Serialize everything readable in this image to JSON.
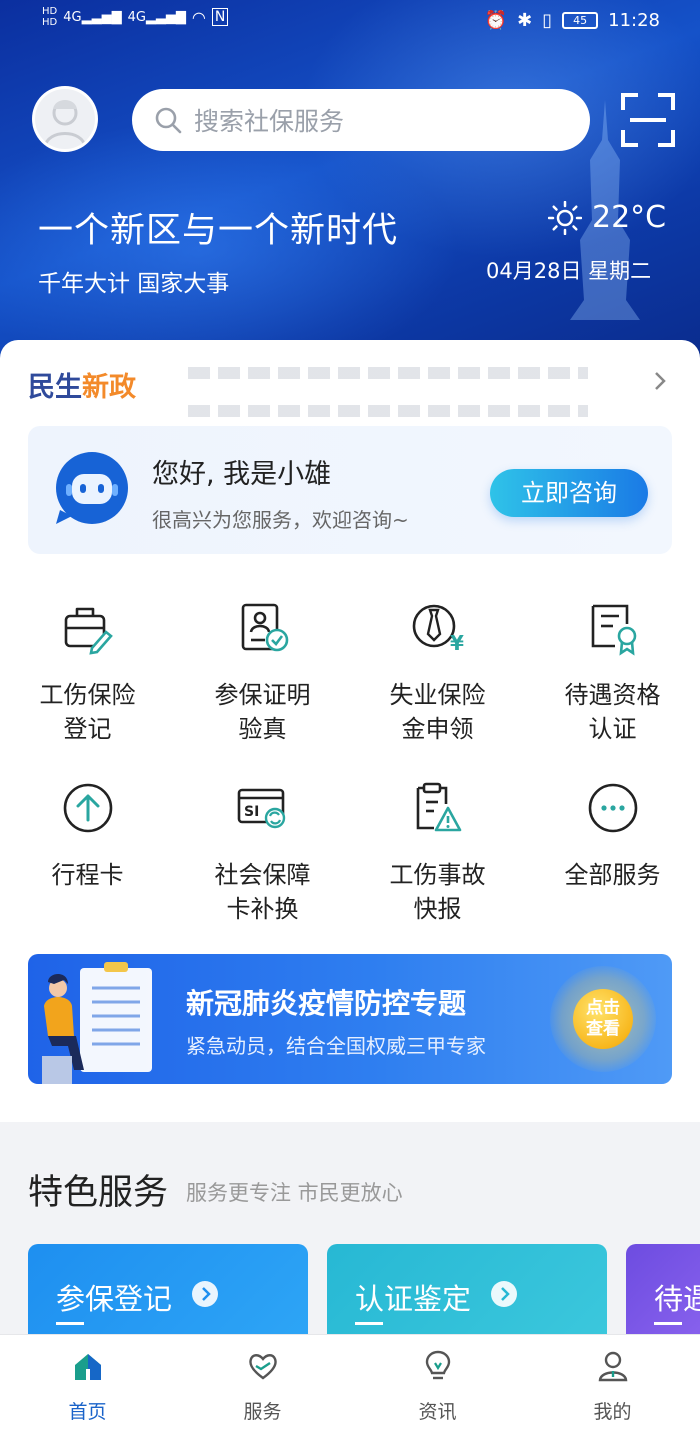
{
  "status_bar": {
    "left_icons": [
      "HD",
      "4G",
      "4G",
      "wifi",
      "NFC"
    ],
    "time": "11:28",
    "battery": "45"
  },
  "header": {
    "search_placeholder": "搜索社保服务",
    "hero_title": "一个新区与一个新时代",
    "hero_subtitle": "千年大计 国家大事",
    "temperature": "22°C",
    "date": "04月28日 星期二"
  },
  "news": {
    "logo_part1": "民生",
    "logo_part2": "新政"
  },
  "assistant": {
    "title": "您好, 我是小雄",
    "subtitle": "很高兴为您服务，欢迎咨询~",
    "button": "立即咨询"
  },
  "services": [
    {
      "label": "工伤保险\n登记",
      "icon": "briefcase-edit-icon"
    },
    {
      "label": "参保证明\n验真",
      "icon": "id-card-check-icon"
    },
    {
      "label": "失业保险\n金申领",
      "icon": "tie-yuan-icon"
    },
    {
      "label": "待遇资格\n认证",
      "icon": "certificate-icon"
    },
    {
      "label": "行程卡",
      "icon": "arrow-up-circle-icon"
    },
    {
      "label": "社会保障\n卡补换",
      "icon": "si-card-refresh-icon"
    },
    {
      "label": "工伤事故\n快报",
      "icon": "clipboard-warning-icon"
    },
    {
      "label": "全部服务",
      "icon": "more-icon"
    }
  ],
  "banner": {
    "title": "新冠肺炎疫情防控专题",
    "subtitle": "紧急动员，结合全国权威三甲专家",
    "button": "点击\n查看"
  },
  "featured": {
    "title": "特色服务",
    "subtitle": "服务更专注 市民更放心",
    "cards": [
      {
        "label": "参保登记",
        "color": "#1e8ff0"
      },
      {
        "label": "认证鉴定",
        "color": "#27b8d4"
      },
      {
        "label": "待遇",
        "color": "#6d4ce0"
      }
    ]
  },
  "nav": {
    "items": [
      {
        "label": "首页",
        "icon": "home-icon"
      },
      {
        "label": "服务",
        "icon": "heart-hand-icon"
      },
      {
        "label": "资讯",
        "icon": "lightbulb-icon"
      },
      {
        "label": "我的",
        "icon": "person-icon"
      }
    ]
  }
}
